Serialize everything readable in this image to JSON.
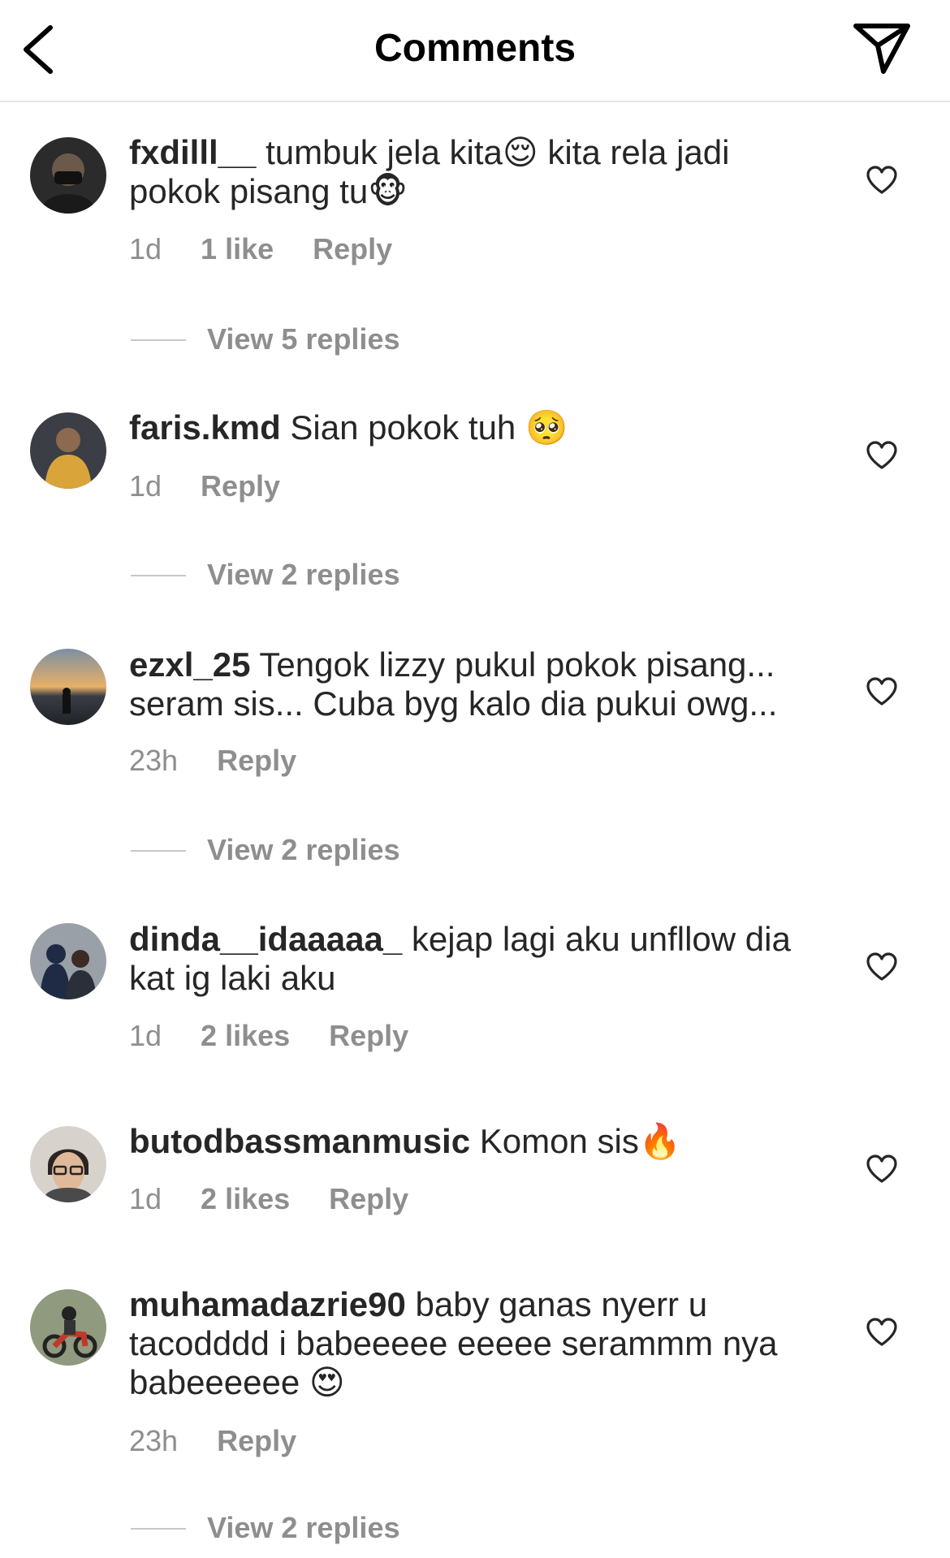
{
  "header": {
    "title": "Comments"
  },
  "comments": [
    {
      "username": "fxdilll__",
      "text": "tumbuk jela kita😌 kita rela jadi pokok pisang tu🐵",
      "time": "1d",
      "likes": "1 like",
      "reply": "Reply",
      "view_replies": "View 5 replies"
    },
    {
      "username": "faris.kmd",
      "text": "Sian pokok tuh 🥺",
      "time": "1d",
      "likes": "",
      "reply": "Reply",
      "view_replies": "View 2 replies"
    },
    {
      "username": "ezxl_25",
      "text": "Tengok lizzy pukul pokok pisang... seram sis... Cuba byg kalo dia pukui owg...",
      "time": "23h",
      "likes": "",
      "reply": "Reply",
      "view_replies": "View 2 replies"
    },
    {
      "username": "dinda__idaaaaa_",
      "text": "kejap lagi aku unfllow dia kat ig laki aku",
      "time": "1d",
      "likes": "2 likes",
      "reply": "Reply",
      "view_replies": ""
    },
    {
      "username": "butodbassmanmusic",
      "text": "Komon sis🔥",
      "time": "1d",
      "likes": "2 likes",
      "reply": "Reply",
      "view_replies": ""
    },
    {
      "username": "muhamadazrie90",
      "text": "baby ganas nyerr u tacodddd i babeeeee eeeee serammm nya babeeeeee 😍",
      "time": "23h",
      "likes": "",
      "reply": "Reply",
      "view_replies": "View 2 replies"
    }
  ],
  "colors": {
    "text": "#262626",
    "muted": "#8e8e8e",
    "divider": "#e6e6e6"
  },
  "icons": {
    "back": "chevron-left-icon",
    "send": "paper-plane-icon",
    "like": "heart-outline-icon"
  }
}
